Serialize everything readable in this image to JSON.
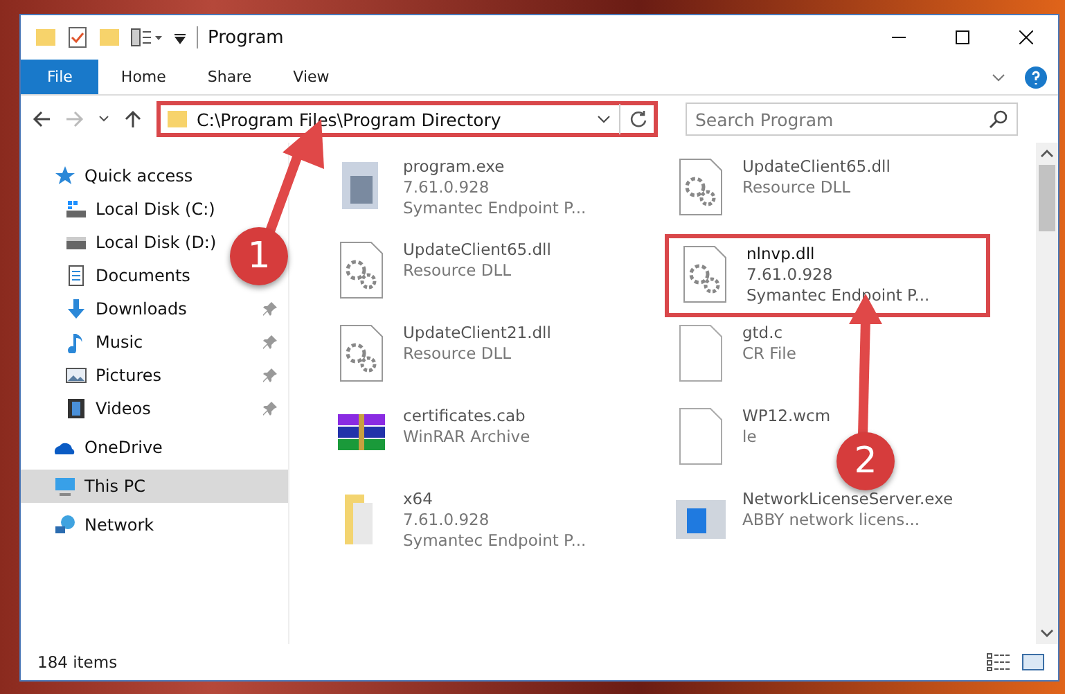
{
  "window": {
    "title": "Program"
  },
  "ribbon_tabs": [
    {
      "label": "File",
      "selected": true
    },
    {
      "label": "Home",
      "selected": false
    },
    {
      "label": "Share",
      "selected": false
    },
    {
      "label": "View",
      "selected": false
    }
  ],
  "address": {
    "path": "C:\\Program Files\\Program Directory",
    "highlighted": true
  },
  "search": {
    "placeholder": "Search Program"
  },
  "sidebar": {
    "items": [
      {
        "label": "Quick access",
        "kind": "star",
        "selected": false,
        "children": [
          {
            "label": "Local Disk (C:)",
            "kind": "disk-c",
            "selected": false
          },
          {
            "label": "Local Disk (D:)",
            "kind": "disk",
            "selected": false
          },
          {
            "label": "Documents",
            "kind": "documents",
            "selected": false
          },
          {
            "label": "Downloads",
            "kind": "download",
            "pinned": true,
            "selected": false
          },
          {
            "label": "Music",
            "kind": "music",
            "pinned": true,
            "selected": false
          },
          {
            "label": "Pictures",
            "kind": "pictures",
            "pinned": true,
            "selected": false
          },
          {
            "label": "Videos",
            "kind": "videos",
            "pinned": true,
            "selected": false
          }
        ]
      },
      {
        "label": "OneDrive",
        "kind": "cloud",
        "selected": false
      },
      {
        "label": "This PC",
        "kind": "pc",
        "selected": true
      },
      {
        "label": "Network",
        "kind": "network",
        "selected": false
      }
    ]
  },
  "files": [
    {
      "kind": "exe",
      "name": "program.exe",
      "lines": [
        "7.61.0.928",
        "Symantec Endpoint P..."
      ],
      "highlighted": false
    },
    {
      "kind": "dll",
      "name": "UpdateClient65.dll",
      "lines": [
        "Resource DLL"
      ],
      "highlighted": false
    },
    {
      "kind": "dll",
      "name": "UpdateClient65.dll",
      "lines": [
        "Resource DLL"
      ],
      "highlighted": false
    },
    {
      "kind": "dll",
      "name": "nlnvp.dll",
      "lines": [
        "7.61.0.928",
        "Symantec Endpoint P..."
      ],
      "highlighted": true
    },
    {
      "kind": "dll",
      "name": "UpdateClient21.dll",
      "lines": [
        "Resource DLL"
      ],
      "highlighted": false
    },
    {
      "kind": "file",
      "name": "gtd.c",
      "lines": [
        "CR File"
      ],
      "highlighted": false
    },
    {
      "kind": "archive",
      "name": "certificates.cab",
      "lines": [
        "WinRAR Archive"
      ],
      "highlighted": false
    },
    {
      "kind": "file",
      "name": "WP12.wcm",
      "lines": [
        "le"
      ],
      "highlighted": false
    },
    {
      "kind": "folder",
      "name": "x64",
      "lines": [
        "7.61.0.928",
        "Symantec Endpoint P..."
      ],
      "highlighted": false
    },
    {
      "kind": "app",
      "name": "NetworkLicenseServer.exe",
      "lines": [
        "ABBY network licens..."
      ],
      "highlighted": false
    }
  ],
  "annotations": [
    {
      "label": "1"
    },
    {
      "label": "2"
    }
  ],
  "status_bar": {
    "count": "184 items"
  }
}
